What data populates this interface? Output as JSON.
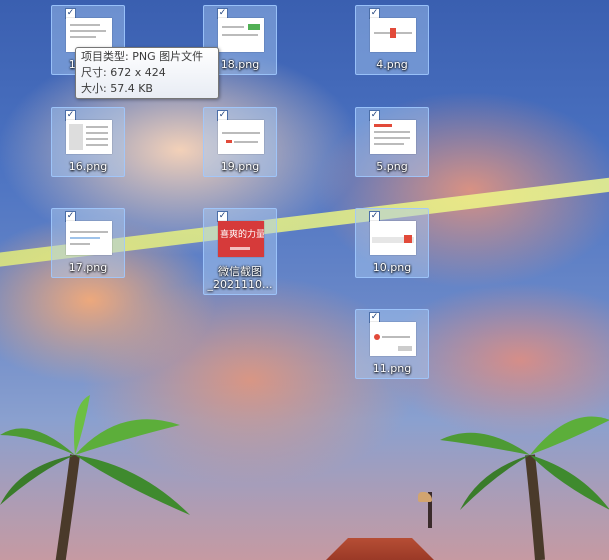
{
  "desktop": {
    "icons": [
      {
        "name": "15.png",
        "label": "15.png",
        "checked": true
      },
      {
        "name": "18.png",
        "label": "18.png",
        "checked": true
      },
      {
        "name": "4.png",
        "label": "4.png",
        "checked": true
      },
      {
        "name": "16.png",
        "label": "16.png",
        "checked": true
      },
      {
        "name": "19.png",
        "label": "19.png",
        "checked": true
      },
      {
        "name": "5.png",
        "label": "5.png",
        "checked": true
      },
      {
        "name": "17.png",
        "label": "17.png",
        "checked": true
      },
      {
        "name": "wechat",
        "label_line1": "微信截图",
        "label_line2": "_2021110...",
        "thumb_text": "喜爽的力量",
        "checked": true
      },
      {
        "name": "10.png",
        "label": "10.png",
        "checked": true
      },
      {
        "name": "11.png",
        "label": "11.png",
        "checked": true
      }
    ]
  },
  "tooltip": {
    "type_line": "项目类型: PNG 图片文件",
    "size_line": "尺寸: 672 x 424",
    "filesize_line": "大小: 57.4 KB"
  },
  "checkmark": "✓"
}
